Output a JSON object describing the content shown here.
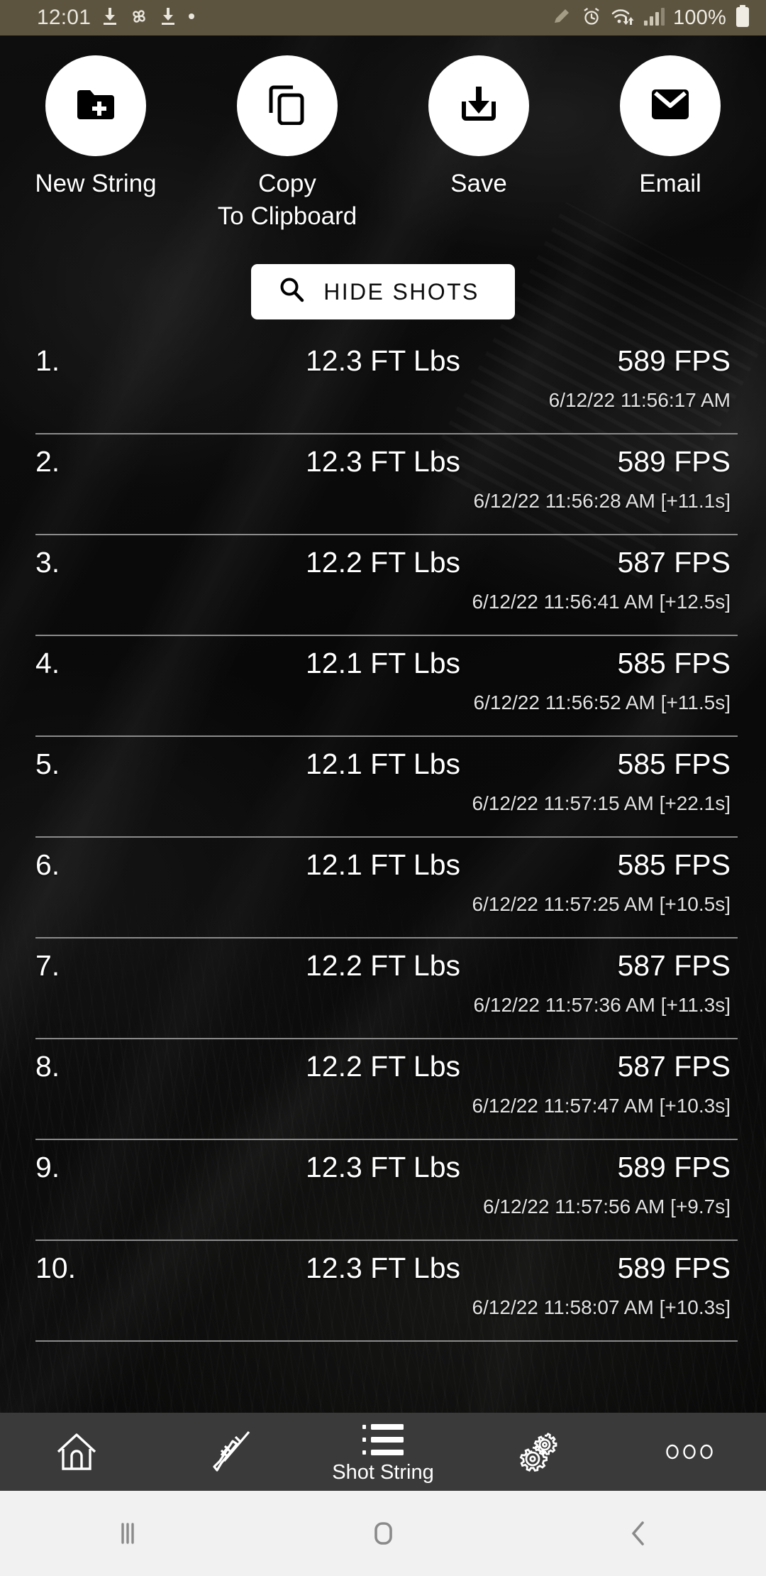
{
  "status_bar": {
    "time": "12:01",
    "battery_percent": "100%",
    "left_icons": [
      "download-icon",
      "pinwheel-icon",
      "download-icon",
      "dot-icon"
    ],
    "right_icons": [
      "pencil-icon",
      "alarm-icon",
      "wifi-icon",
      "signal-icon",
      "battery-icon"
    ],
    "background_color": "#5d5440"
  },
  "actions": [
    {
      "label": "New String",
      "icon": "folder-plus-icon"
    },
    {
      "label": "Copy\nTo Clipboard",
      "icon": "copy-icon"
    },
    {
      "label": "Save",
      "icon": "download-icon"
    },
    {
      "label": "Email",
      "icon": "envelope-icon"
    }
  ],
  "hide_shots": {
    "label": "HIDE SHOTS",
    "icon": "search-icon"
  },
  "shots": [
    {
      "index": "1.",
      "energy": "12.3 FT Lbs",
      "speed": "589 FPS",
      "timestamp": "6/12/22 11:56:17 AM"
    },
    {
      "index": "2.",
      "energy": "12.3 FT Lbs",
      "speed": "589 FPS",
      "timestamp": "6/12/22 11:56:28 AM [+11.1s]"
    },
    {
      "index": "3.",
      "energy": "12.2 FT Lbs",
      "speed": "587 FPS",
      "timestamp": "6/12/22 11:56:41 AM [+12.5s]"
    },
    {
      "index": "4.",
      "energy": "12.1 FT Lbs",
      "speed": "585 FPS",
      "timestamp": "6/12/22 11:56:52 AM [+11.5s]"
    },
    {
      "index": "5.",
      "energy": "12.1 FT Lbs",
      "speed": "585 FPS",
      "timestamp": "6/12/22 11:57:15 AM [+22.1s]"
    },
    {
      "index": "6.",
      "energy": "12.1 FT Lbs",
      "speed": "585 FPS",
      "timestamp": "6/12/22 11:57:25 AM [+10.5s]"
    },
    {
      "index": "7.",
      "energy": "12.2 FT Lbs",
      "speed": "587 FPS",
      "timestamp": "6/12/22 11:57:36 AM [+11.3s]"
    },
    {
      "index": "8.",
      "energy": "12.2 FT Lbs",
      "speed": "587 FPS",
      "timestamp": "6/12/22 11:57:47 AM [+10.3s]"
    },
    {
      "index": "9.",
      "energy": "12.3 FT Lbs",
      "speed": "589 FPS",
      "timestamp": "6/12/22 11:57:56 AM [+9.7s]"
    },
    {
      "index": "10.",
      "energy": "12.3 FT Lbs",
      "speed": "589 FPS",
      "timestamp": "6/12/22 11:58:07 AM [+10.3s]"
    }
  ],
  "app_nav": {
    "background_color": "#3a3a3a",
    "items": [
      {
        "icon": "home-icon",
        "label": ""
      },
      {
        "icon": "rifle-icon",
        "label": ""
      },
      {
        "icon": "list-icon",
        "label": "Shot String"
      },
      {
        "icon": "gears-icon",
        "label": ""
      },
      {
        "icon": "more-dots-icon",
        "label": ""
      }
    ]
  },
  "system_nav": {
    "background_color": "#f1f1f1",
    "items": [
      "recents-icon",
      "home-icon",
      "back-icon"
    ]
  }
}
